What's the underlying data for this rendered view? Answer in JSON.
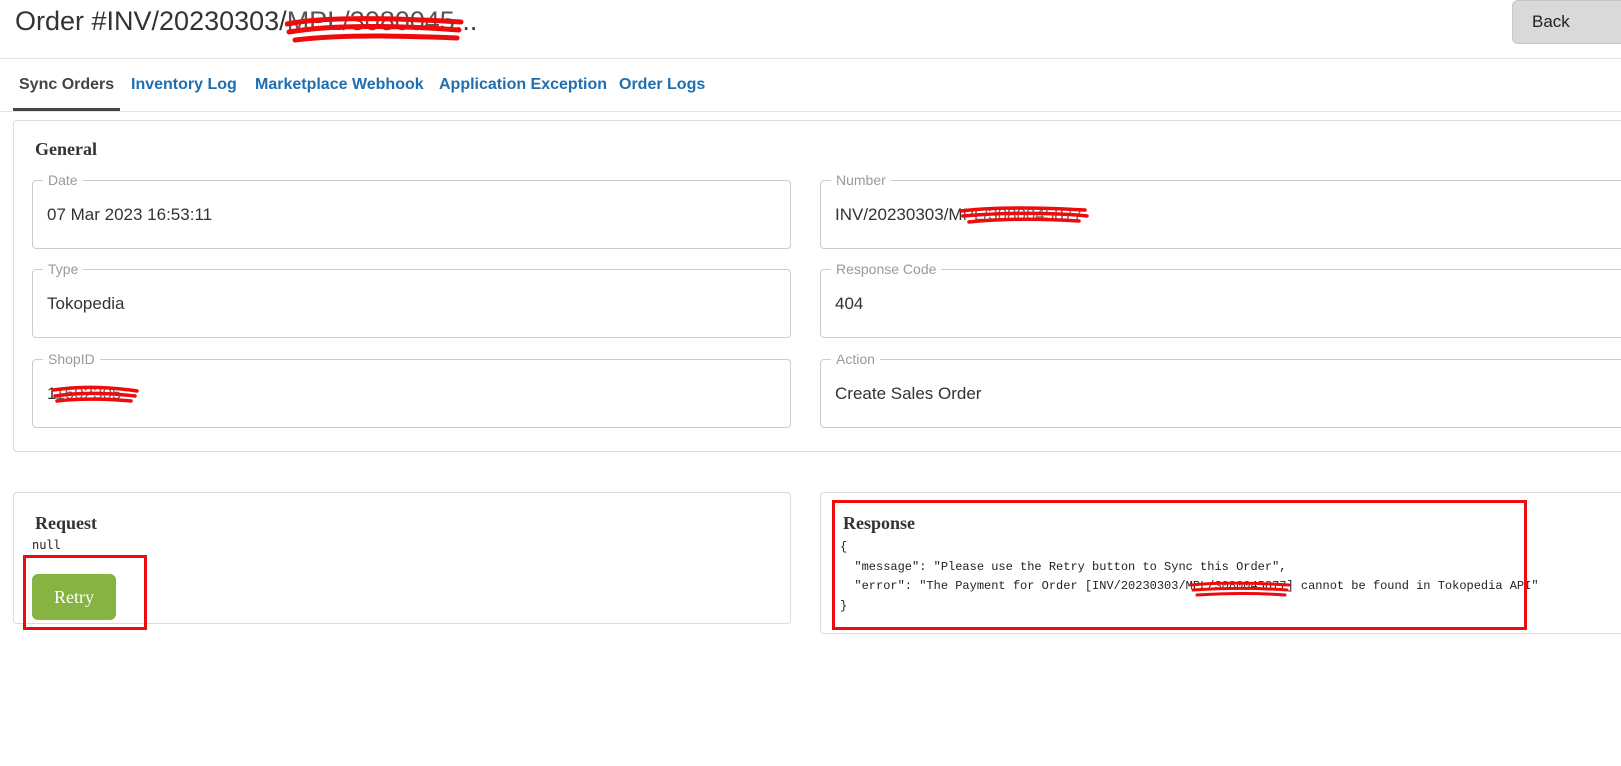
{
  "header": {
    "title_prefix": "Order #INV/20230303/",
    "title_redacted": "MPL/3080045",
    "title_suffix": "...",
    "back_label": "Back"
  },
  "tabs": [
    {
      "label": "Sync Orders",
      "active": true
    },
    {
      "label": "Inventory Log"
    },
    {
      "label": "Marketplace Webhook"
    },
    {
      "label": "Application Exception"
    },
    {
      "label": "Order Logs"
    }
  ],
  "general": {
    "title": "General",
    "fields": [
      {
        "label": "Date",
        "value": "07 Mar 2023 16:53:11"
      },
      {
        "label": "Number",
        "value_prefix": "INV/20230303/M",
        "value_redacted": "PL/3080045877"
      },
      {
        "label": "Type",
        "value": "Tokopedia"
      },
      {
        "label": "Response Code",
        "value": "404"
      },
      {
        "label": "ShopID",
        "value_prefix": "1",
        "value_redacted": "1602305"
      },
      {
        "label": "Action",
        "value": "Create Sales Order"
      }
    ]
  },
  "request": {
    "title": "Request",
    "body": "null",
    "retry_label": "Retry"
  },
  "response": {
    "title": "Response",
    "line1": "{",
    "line2": "  \"message\": \"Please use the Retry button to Sync this Order\",",
    "line3_prefix": "  \"error\": \"The Payment for Order [INV/20230303/M",
    "line3_redacted": "PL/3080045877",
    "line3_suffix": "] cannot be found in Tokopedia API\"",
    "line4": "}"
  },
  "colors": {
    "tab_link": "#1f6fb0",
    "retry_green": "#86b342",
    "highlight_red": "#ee0b0b"
  }
}
